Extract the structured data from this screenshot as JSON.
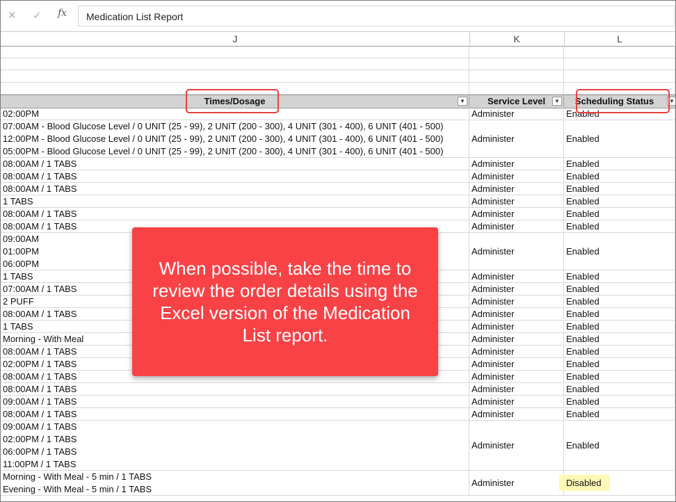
{
  "formula_bar": {
    "cancel_icon": "close-x-icon",
    "enter_icon": "checkmark-icon",
    "fx_label": "fx",
    "content": "Medication List Report"
  },
  "columns": {
    "j": "J",
    "k": "K",
    "l": "L"
  },
  "table_headers": {
    "times": "Times/Dosage",
    "service": "Service Level",
    "status": "Scheduling Status",
    "dropdown_glyph": "▼"
  },
  "rows": [
    {
      "times": [
        "02:00PM"
      ],
      "service": "Administer",
      "status": "Enabled"
    },
    {
      "times": [
        "07:00AM - Blood Glucose Level / 0 UNIT (25 - 99), 2 UNIT (200 - 300), 4 UNIT (301 - 400), 6 UNIT (401 - 500)",
        "12:00PM - Blood Glucose Level / 0 UNIT (25 - 99), 2 UNIT (200 - 300), 4 UNIT (301 - 400), 6 UNIT (401 - 500)",
        "05:00PM - Blood Glucose Level / 0 UNIT (25 - 99), 2 UNIT (200 - 300), 4 UNIT (301 - 400), 6 UNIT (401 - 500)"
      ],
      "service": "Administer",
      "status": "Enabled"
    },
    {
      "times": [
        "08:00AM / 1 TABS"
      ],
      "service": "Administer",
      "status": "Enabled"
    },
    {
      "times": [
        "08:00AM / 1 TABS"
      ],
      "service": "Administer",
      "status": "Enabled"
    },
    {
      "times": [
        "08:00AM / 1 TABS"
      ],
      "service": "Administer",
      "status": "Enabled"
    },
    {
      "times": [
        "1 TABS"
      ],
      "service": "Administer",
      "status": "Enabled"
    },
    {
      "times": [
        "08:00AM / 1 TABS"
      ],
      "service": "Administer",
      "status": "Enabled"
    },
    {
      "times": [
        "08:00AM / 1 TABS"
      ],
      "service": "Administer",
      "status": "Enabled"
    },
    {
      "times": [
        "09:00AM",
        "01:00PM",
        "06:00PM"
      ],
      "service": "Administer",
      "status": "Enabled"
    },
    {
      "times": [
        "1 TABS"
      ],
      "service": "Administer",
      "status": "Enabled"
    },
    {
      "times": [
        "07:00AM / 1 TABS"
      ],
      "service": "Administer",
      "status": "Enabled"
    },
    {
      "times": [
        "2 PUFF"
      ],
      "service": "Administer",
      "status": "Enabled"
    },
    {
      "times": [
        "08:00AM / 1 TABS"
      ],
      "service": "Administer",
      "status": "Enabled"
    },
    {
      "times": [
        "1 TABS"
      ],
      "service": "Administer",
      "status": "Enabled"
    },
    {
      "times": [
        "Morning - With Meal"
      ],
      "service": "Administer",
      "status": "Enabled"
    },
    {
      "times": [
        "08:00AM / 1 TABS"
      ],
      "service": "Administer",
      "status": "Enabled"
    },
    {
      "times": [
        "02:00PM / 1 TABS"
      ],
      "service": "Administer",
      "status": "Enabled"
    },
    {
      "times": [
        "08:00AM / 1 TABS"
      ],
      "service": "Administer",
      "status": "Enabled"
    },
    {
      "times": [
        "08:00AM / 1 TABS"
      ],
      "service": "Administer",
      "status": "Enabled"
    },
    {
      "times": [
        "09:00AM / 1 TABS"
      ],
      "service": "Administer",
      "status": "Enabled"
    },
    {
      "times": [
        "08:00AM / 1 TABS"
      ],
      "service": "Administer",
      "status": "Enabled"
    },
    {
      "times": [
        "09:00AM / 1 TABS",
        "02:00PM / 1 TABS",
        "06:00PM / 1 TABS",
        "11:00PM / 1 TABS"
      ],
      "service": "Administer",
      "status": "Enabled"
    },
    {
      "times": [
        "Morning - With Meal - 5 min / 1 TABS",
        "Evening - With Meal - 5 min / 1 TABS"
      ],
      "service": "Administer",
      "status": "Disabled",
      "status_highlight": true
    }
  ],
  "callout": {
    "text": "When possible, take the time to review the order details using the Excel version of the Medication List report.",
    "color": "#f84245"
  },
  "highlight_colors": {
    "annotation_box": "#e8403f",
    "disabled_cell": "#fff9b6"
  }
}
